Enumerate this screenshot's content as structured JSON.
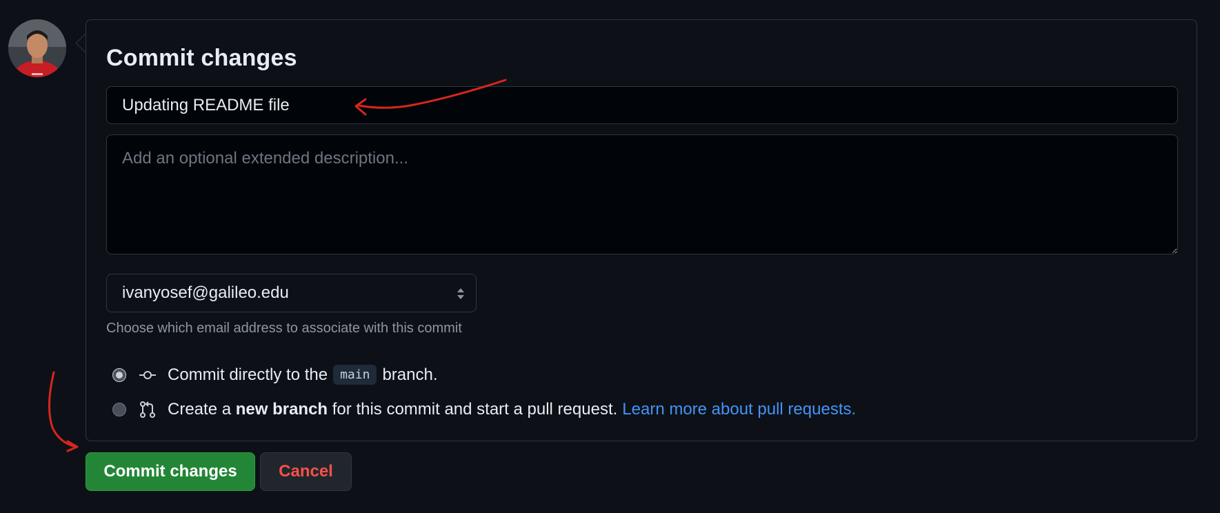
{
  "avatar": {
    "icon": "user-avatar"
  },
  "commit_form": {
    "title": "Commit changes",
    "summary_value": "Updating README file",
    "description_placeholder": "Add an optional extended description...",
    "email": {
      "selected": "ivanyosef@galileo.edu",
      "hint": "Choose which email address to associate with this commit"
    },
    "options": [
      {
        "checked": true,
        "icon": "git-commit-icon",
        "prefix": "Commit directly to the",
        "branch": "main",
        "suffix": "branch."
      },
      {
        "checked": false,
        "icon": "git-pull-request-icon",
        "prefix": "Create a",
        "bold": "new branch",
        "suffix": "for this commit and start a pull request.",
        "link": "Learn more about pull requests."
      }
    ]
  },
  "buttons": {
    "commit_label": "Commit changes",
    "cancel_label": "Cancel"
  },
  "colors": {
    "background": "#0d1117",
    "accent_green": "#238636",
    "danger_red": "#f85149",
    "link_blue": "#4493f8",
    "annotation_red": "#d9261c"
  }
}
